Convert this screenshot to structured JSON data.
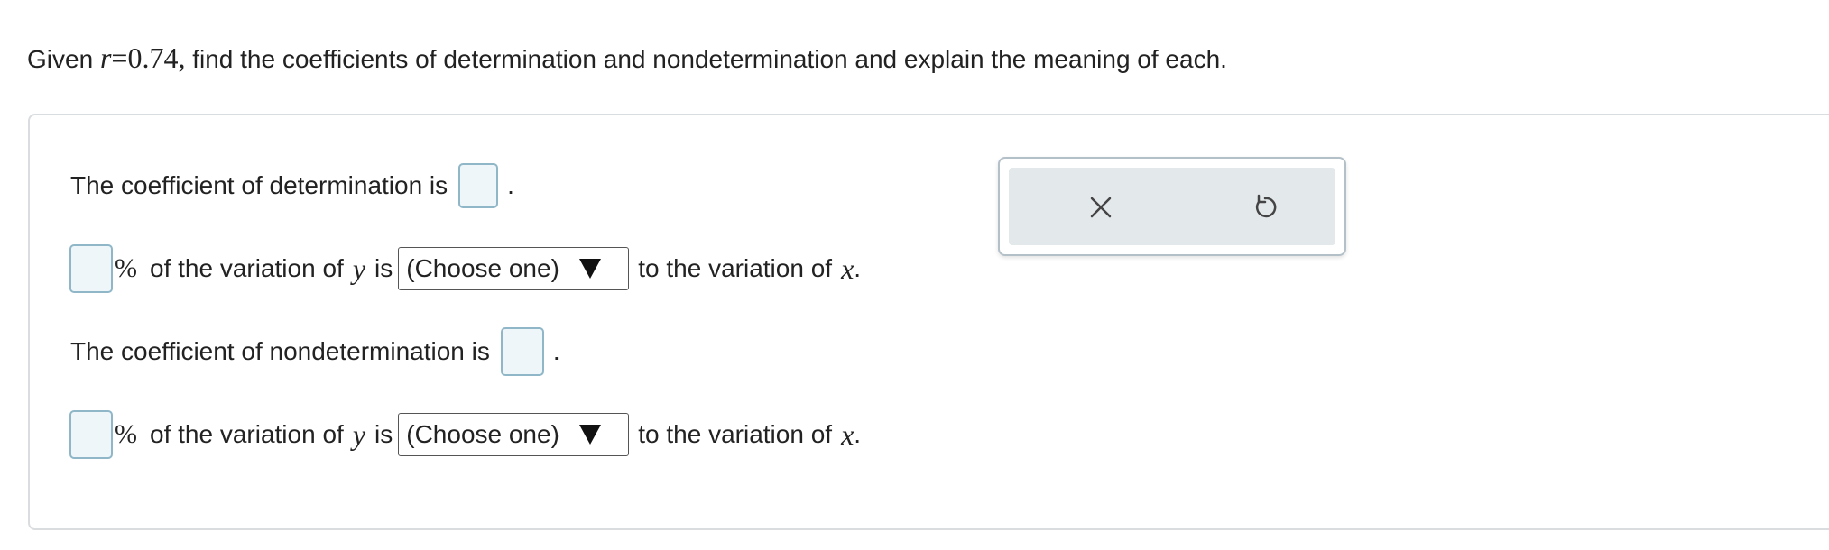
{
  "question": {
    "prefix": "Given ",
    "r_var": "r",
    "equals": "=",
    "r_value": "0.74",
    "comma": ",",
    "rest": " find the coefficients of determination and nondetermination and explain the meaning of each."
  },
  "answer_panel": {
    "determination": {
      "label": "The coefficient of determination is",
      "value": "",
      "period": "."
    },
    "determination_explanation": {
      "percent_value": "",
      "percent_sign": "%",
      "of_variation_text": "of the variation of",
      "y_var": "y",
      "is_text": "is",
      "select_value": "(Choose one)",
      "to_variation_text": "to the variation of",
      "x_var": "x",
      "end_period": "."
    },
    "nondetermination": {
      "label": "The coefficient of nondetermination is",
      "value": "",
      "period": "."
    },
    "nondetermination_explanation": {
      "percent_value": "",
      "percent_sign": "%",
      "of_variation_text": "of the variation of",
      "y_var": "y",
      "is_text": "is",
      "select_value": "(Choose one)",
      "to_variation_text": "to the variation of",
      "x_var": "x",
      "end_period": "."
    }
  },
  "toolbar": {
    "clear_icon": "close-icon",
    "undo_icon": "undo-icon"
  },
  "colors": {
    "answer_box_border": "#8fb7c8",
    "answer_box_fill": "#eef6f9",
    "toolbar_fill": "#e3e8eb",
    "panel_border": "#d9dde0",
    "icon": "#444444"
  }
}
